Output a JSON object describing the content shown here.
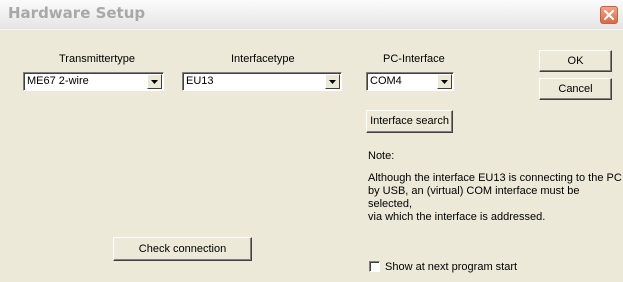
{
  "window": {
    "title": "Hardware Setup"
  },
  "labels": {
    "transmitter": "Transmittertype",
    "interface": "Interfacetype",
    "pc_interface": "PC-Interface"
  },
  "fields": {
    "transmitter_value": "ME67 2-wire",
    "interface_value": "EU13",
    "pc_interface_value": "COM4"
  },
  "buttons": {
    "ok": "OK",
    "cancel": "Cancel",
    "interface_search": "Interface search",
    "check_connection": "Check connection"
  },
  "note": {
    "heading": "Note:",
    "line1": "Although the interface EU13 is connecting to the PC",
    "line2": "by USB, an (virtual) COM interface must be selected,",
    "line3": "via which the interface is addressed."
  },
  "checkbox": {
    "label": "Show at next program start",
    "checked": false
  },
  "icons": {
    "close": "close-icon",
    "dropdown": "chevron-down-icon"
  },
  "colors": {
    "background": "#ece9d8",
    "close_button": "#d86a48"
  }
}
